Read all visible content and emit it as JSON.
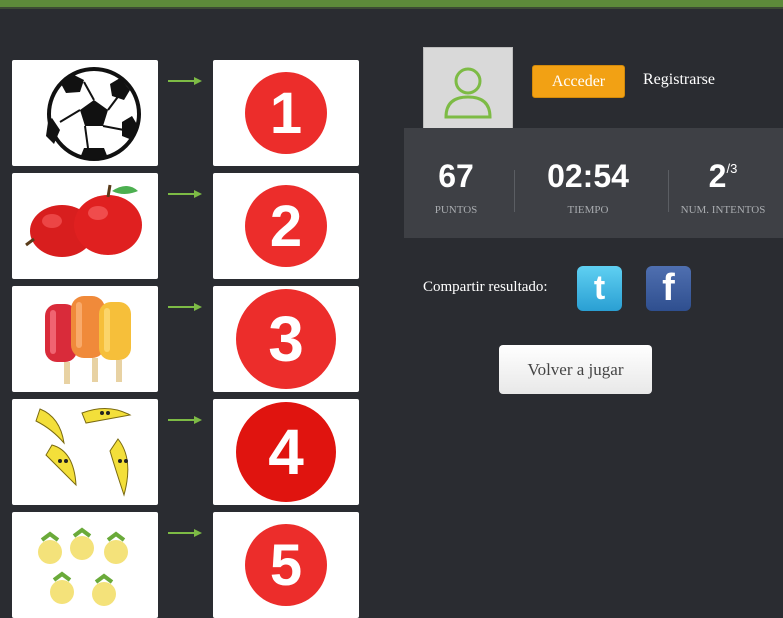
{
  "pairs": [
    {
      "image": "soccer-ball",
      "number": "1"
    },
    {
      "image": "red-apples",
      "number": "2"
    },
    {
      "image": "popsicles",
      "number": "3"
    },
    {
      "image": "dancing-bananas",
      "number": "4"
    },
    {
      "image": "smiling-pineapples",
      "number": "5"
    }
  ],
  "auth": {
    "login_label": "Acceder",
    "register_label": "Registrarse"
  },
  "stats": {
    "points_value": "67",
    "points_label": "PUNTOS",
    "time_value": "02:54",
    "time_label": "TIEMPO",
    "attempts_value": "2",
    "attempts_max": "/3",
    "attempts_label": "NUM. INTENTOS"
  },
  "share": {
    "label": "Compartir resultado:",
    "twitter_glyph": "t",
    "facebook_glyph": "f"
  },
  "replay": {
    "label": "Volver a jugar"
  },
  "colors": {
    "accent": "#f2a114",
    "number_circle": "#ec2d2b",
    "arrow": "#7dbb45",
    "avatar_icon": "#7dbb45"
  }
}
